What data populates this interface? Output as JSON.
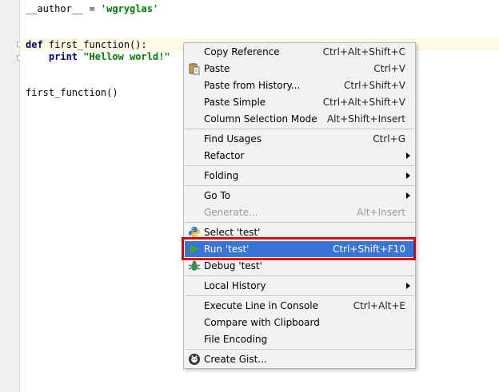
{
  "editor": {
    "lines": {
      "l1_a": "__author__ = ",
      "l1_b": "'wgryglas'",
      "l2_kw": "def",
      "l2_rest": " first_function():",
      "l3_kw": "print",
      "l3_str": "\"Hellow world!\"",
      "l4": "first_function()"
    },
    "colors": {
      "keyword": "#000080",
      "string": "#008000",
      "current_line": "#fffae3"
    }
  },
  "context_menu": {
    "items": [
      {
        "label": "Copy Reference",
        "shortcut": "Ctrl+Alt+Shift+C"
      },
      {
        "label": "Paste",
        "shortcut": "Ctrl+V",
        "icon": "clipboard-icon"
      },
      {
        "label": "Paste from History...",
        "shortcut": "Ctrl+Shift+V"
      },
      {
        "label": "Paste Simple",
        "shortcut": "Ctrl+Alt+Shift+V"
      },
      {
        "label": "Column Selection Mode",
        "shortcut": "Alt+Shift+Insert"
      },
      {
        "label": "Find Usages",
        "shortcut": "Ctrl+G"
      },
      {
        "label": "Refactor",
        "submenu": true
      },
      {
        "label": "Folding",
        "submenu": true
      },
      {
        "label": "Go To",
        "submenu": true
      },
      {
        "label": "Generate...",
        "shortcut": "Alt+Insert",
        "disabled": true
      },
      {
        "label": "Select 'test'",
        "icon": "python-icon"
      },
      {
        "label": "Run 'test'",
        "shortcut": "Ctrl+Shift+F10",
        "icon": "run-icon",
        "selected": true
      },
      {
        "label": "Debug 'test'",
        "icon": "debug-icon"
      },
      {
        "label": "Local History",
        "submenu": true
      },
      {
        "label": "Execute Line in Console",
        "shortcut": "Ctrl+Alt+E"
      },
      {
        "label": "Compare with Clipboard"
      },
      {
        "label": "File Encoding"
      },
      {
        "label": "Create Gist...",
        "icon": "github-icon"
      }
    ],
    "colors": {
      "selection": "#3875d7",
      "highlight_box": "#e0000a"
    }
  }
}
